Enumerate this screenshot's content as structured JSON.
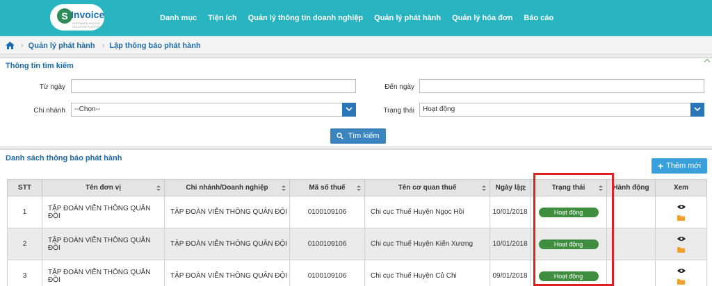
{
  "app": {
    "logo_text": "Invoice",
    "logo_letter": "S",
    "logo_sub": "SOFTWARE INVOICE SOLUTION PLATFORM",
    "brand_color": "#29b4c2"
  },
  "nav": [
    "Danh mục",
    "Tiện ích",
    "Quản lý thông tin doanh nghiệp",
    "Quản lý phát hành",
    "Quản lý hóa đơn",
    "Báo cáo"
  ],
  "breadcrumb": [
    "Quản lý phát hành",
    "Lập thông báo phát hành"
  ],
  "search": {
    "title": "Thông tin tìm kiếm",
    "from_label": "Từ ngày",
    "from_value": "",
    "to_label": "Đến ngày",
    "to_value": "",
    "branch_label": "Chi nhánh",
    "branch_value": "--Chọn--",
    "status_label": "Trạng thái",
    "status_value": "Hoạt động",
    "button": "Tìm kiếm"
  },
  "list": {
    "title": "Danh sách thông báo phát hành",
    "add_button": "Thêm mới",
    "columns": [
      "STT",
      "Tên đơn vị",
      "Chi nhánh/Doanh nghiệp",
      "Mã số thuế",
      "Tên cơ quan thuế",
      "Ngày lập",
      "Trạng thái",
      "Hành động",
      "Xem"
    ],
    "rows": [
      {
        "stt": "1",
        "unit": "TẬP ĐOÀN VIỄN THÔNG QUÂN ĐỘI",
        "branch": "TẬP ĐOÀN VIỄN THÔNG QUÂN ĐỘI",
        "tax": "0100109106",
        "office": "Chi cục Thuế Huyện Ngọc Hồi",
        "date": "10/01/2018",
        "status": "Hoạt động"
      },
      {
        "stt": "2",
        "unit": "TẬP ĐOÀN VIỄN THÔNG QUÂN ĐỘI",
        "branch": "TẬP ĐOÀN VIỄN THÔNG QUÂN ĐỘI",
        "tax": "0100109106",
        "office": "Chi cục Thuế Huyện Kiến Xương",
        "date": "10/01/2018",
        "status": "Hoạt động"
      },
      {
        "stt": "3",
        "unit": "TẬP ĐOÀN VIỄN THÔNG QUÂN ĐỘI",
        "branch": "TẬP ĐOÀN VIỄN THÔNG QUÂN ĐỘI",
        "tax": "0100109106",
        "office": "Chi cục Thuế Huyện Củ Chi",
        "date": "09/01/2018",
        "status": "Hoạt động"
      }
    ]
  },
  "icons": {
    "home": "home-icon",
    "search": "search-icon",
    "view": "eye-icon",
    "open": "folder-icon",
    "dropdown": "chevron-down-icon"
  },
  "colors": {
    "status_active": "#3f8e3f",
    "highlight": "#e02020",
    "primary_button": "#3a84c0"
  }
}
